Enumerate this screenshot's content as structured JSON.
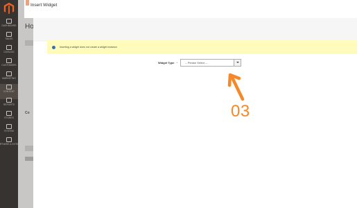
{
  "sidebar": {
    "items": [
      {
        "icon": "dashboard-icon",
        "label": "DASHBOARD"
      },
      {
        "icon": "dollar-icon",
        "label": "SALES"
      },
      {
        "icon": "catalog-icon",
        "label": "CATALOG"
      },
      {
        "icon": "customers-icon",
        "label": "CUSTOMERS"
      },
      {
        "icon": "marketing-icon",
        "label": "MARKETING"
      },
      {
        "icon": "content-icon",
        "label": "CONTENT"
      },
      {
        "icon": "reports-icon",
        "label": "REPORTS"
      },
      {
        "icon": "stores-icon",
        "label": "STORES"
      },
      {
        "icon": "system-icon",
        "label": "SYSTEM"
      },
      {
        "icon": "extensions-icon",
        "label": "FIND PARTNERS & EXTENSIONS"
      }
    ],
    "active_index": 5
  },
  "background_page": {
    "heading": "Ho",
    "sub": "Co"
  },
  "modal": {
    "title": "Insert Widget",
    "notice": "Inserting a widget does not create a widget instance.",
    "field_label": "Widget Type",
    "required_mark": "*",
    "select_value": "-- Please Select --"
  },
  "annotation": {
    "step": "03",
    "color": "#f5892a"
  }
}
